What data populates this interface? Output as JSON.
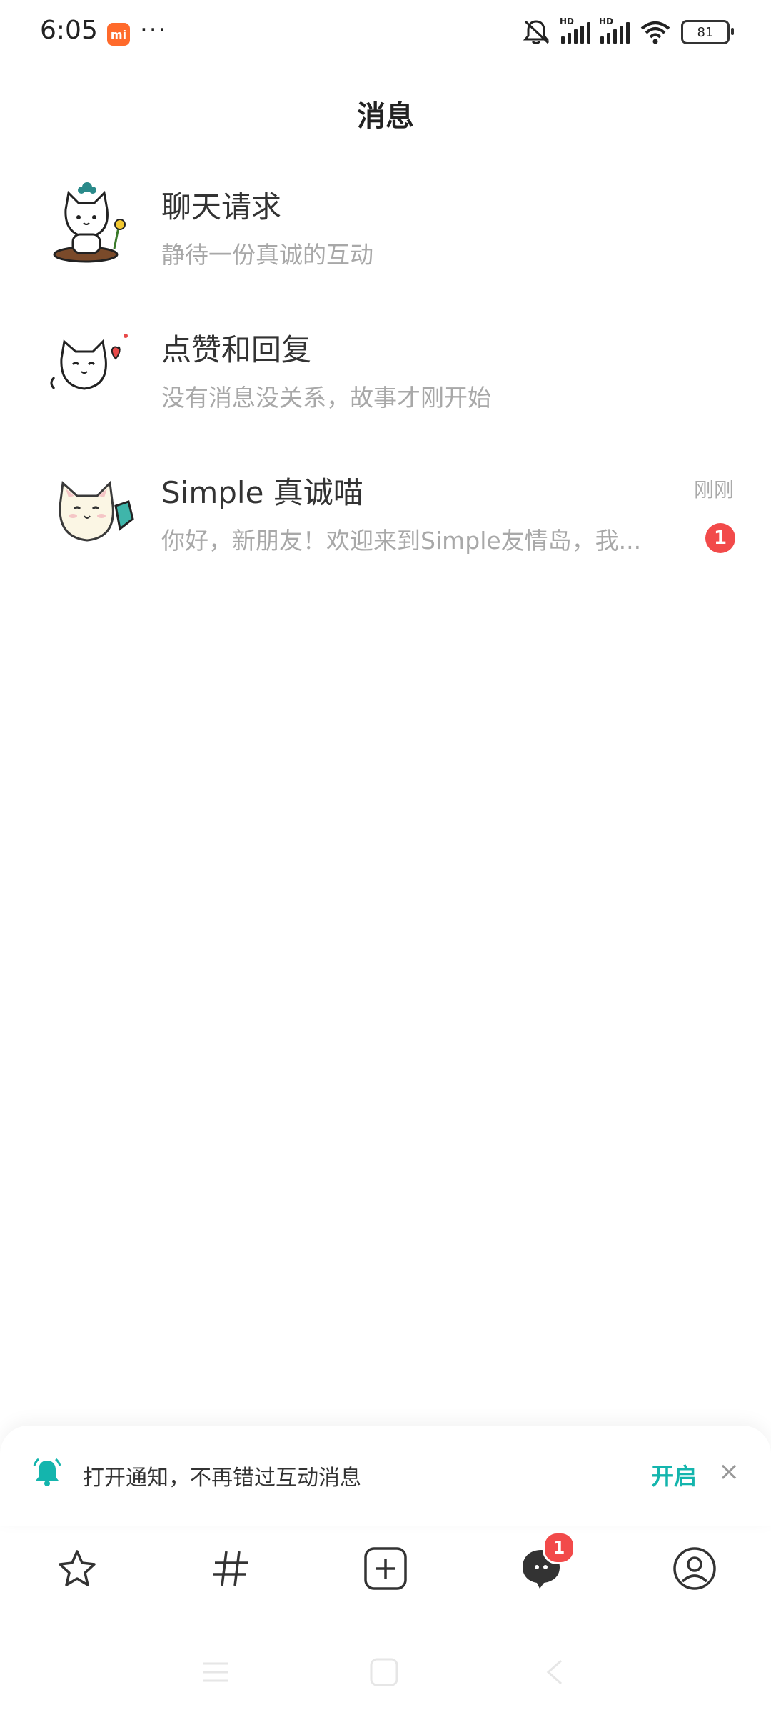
{
  "status_bar": {
    "time": "6:05",
    "mi_label": "mi",
    "more": "···",
    "signal_label_1": "HD",
    "signal_label_2": "HD",
    "battery": "81"
  },
  "header": {
    "title": "消息"
  },
  "messages": [
    {
      "title": "聊天请求",
      "subtitle": "静待一份真诚的互动",
      "avatar_icon": "cat-with-flower-icon"
    },
    {
      "title": "点赞和回复",
      "subtitle": "没有消息没关系，故事才刚开始",
      "avatar_icon": "cat-with-heart-icon"
    },
    {
      "title": "Simple 真诚喵",
      "subtitle": "你好，新朋友！欢迎来到Simple友情岛，我...",
      "time": "刚刚",
      "unread": "1",
      "avatar_icon": "cream-cat-icon"
    }
  ],
  "notification": {
    "text": "打开通知，不再错过互动消息",
    "action": "开启",
    "close": "×",
    "accent": "#14b5ad"
  },
  "bottom_nav": {
    "items": [
      {
        "icon": "star-icon"
      },
      {
        "icon": "hash-icon"
      },
      {
        "icon": "add-square-icon"
      },
      {
        "icon": "chat-bubble-icon",
        "badge": "1"
      },
      {
        "icon": "profile-icon"
      }
    ]
  },
  "colors": {
    "badge_red": "#f24a4a",
    "accent": "#14b5ad"
  }
}
